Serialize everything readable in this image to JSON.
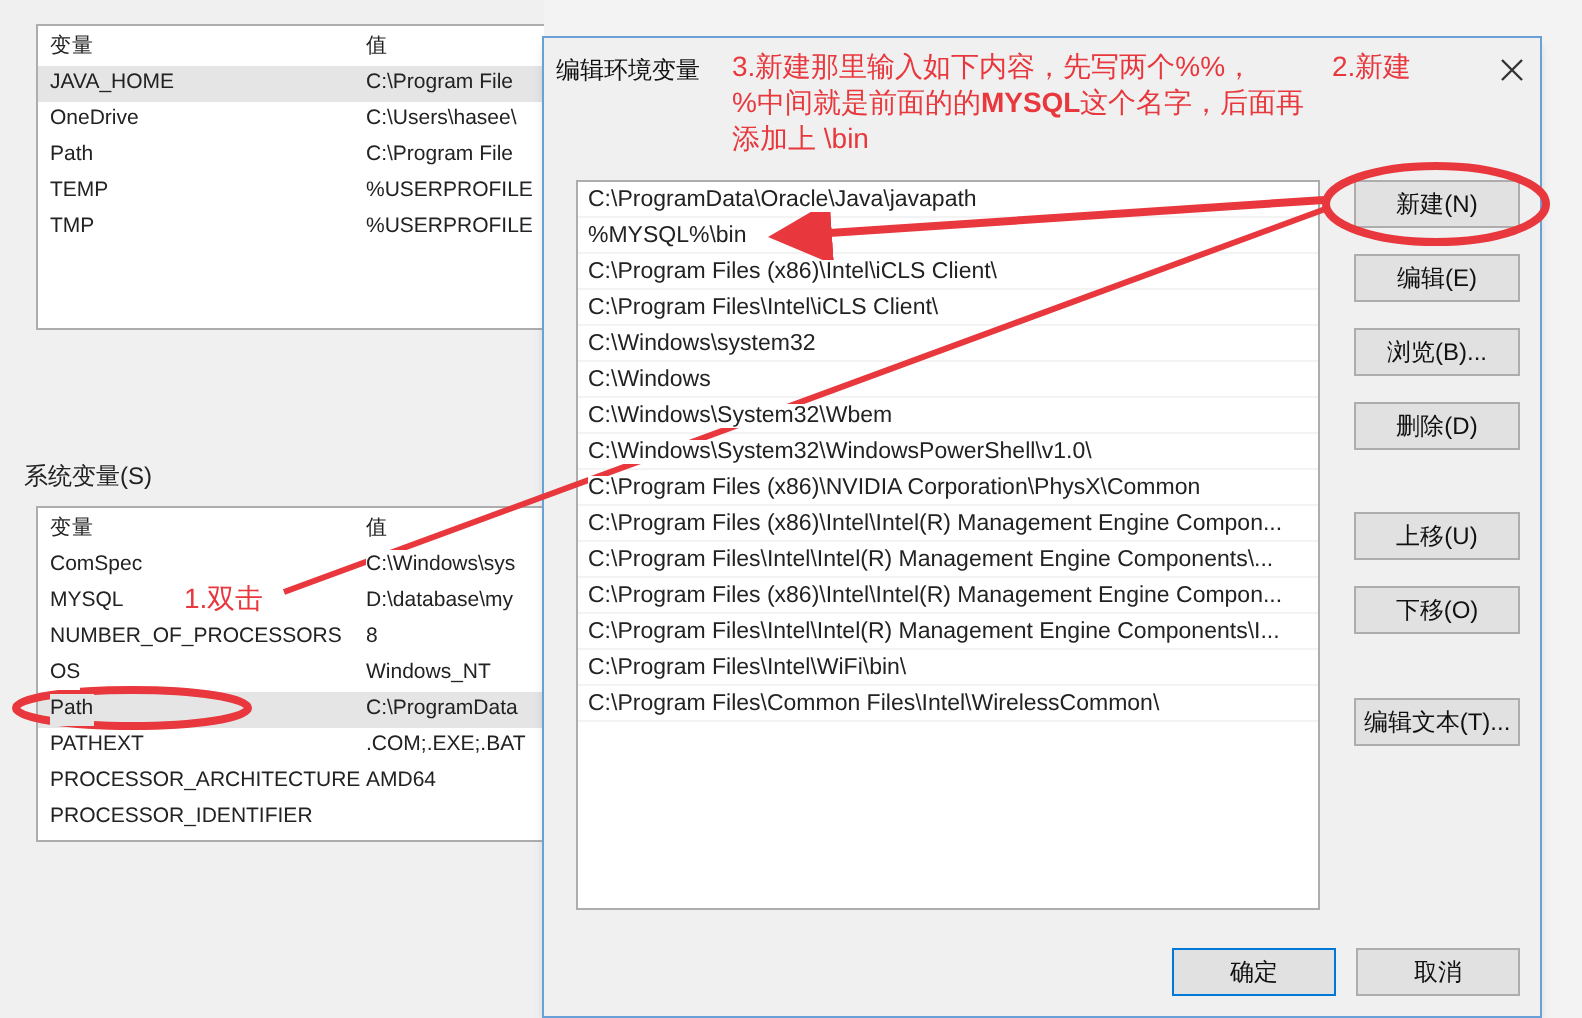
{
  "background_window": {
    "user_variables": {
      "columns": [
        "变量",
        "值"
      ],
      "rows": [
        {
          "name": "JAVA_HOME",
          "value": "C:\\Program File",
          "selected": true
        },
        {
          "name": "OneDrive",
          "value": "C:\\Users\\hasee\\",
          "selected": false
        },
        {
          "name": "Path",
          "value": "C:\\Program File",
          "selected": false
        },
        {
          "name": "TEMP",
          "value": "%USERPROFILE",
          "selected": false
        },
        {
          "name": "TMP",
          "value": "%USERPROFILE",
          "selected": false
        }
      ]
    },
    "system_variables": {
      "label": "系统变量(S)",
      "columns": [
        "变量",
        "值"
      ],
      "rows": [
        {
          "name": "ComSpec",
          "value": "C:\\Windows\\sys",
          "selected": false
        },
        {
          "name": "MYSQL",
          "value": "D:\\database\\my",
          "selected": false
        },
        {
          "name": "NUMBER_OF_PROCESSORS",
          "value": "8",
          "selected": false
        },
        {
          "name": "OS",
          "value": "Windows_NT",
          "selected": false
        },
        {
          "name": "Path",
          "value": "C:\\ProgramData",
          "selected": true
        },
        {
          "name": "PATHEXT",
          "value": ".COM;.EXE;.BAT",
          "selected": false
        },
        {
          "name": "PROCESSOR_ARCHITECTURE",
          "value": "AMD64",
          "selected": false
        },
        {
          "name": "PROCESSOR_IDENTIFIER",
          "value": "",
          "selected": false
        }
      ]
    }
  },
  "dialog": {
    "title": "编辑环境变量",
    "entries": [
      "C:\\ProgramData\\Oracle\\Java\\javapath",
      "%MYSQL%\\bin",
      "C:\\Program Files (x86)\\Intel\\iCLS Client\\",
      "C:\\Program Files\\Intel\\iCLS Client\\",
      "C:\\Windows\\system32",
      "C:\\Windows",
      "C:\\Windows\\System32\\Wbem",
      "C:\\Windows\\System32\\WindowsPowerShell\\v1.0\\",
      "C:\\Program Files (x86)\\NVIDIA Corporation\\PhysX\\Common",
      "C:\\Program Files (x86)\\Intel\\Intel(R) Management Engine Compon...",
      "C:\\Program Files\\Intel\\Intel(R) Management Engine Components\\...",
      "C:\\Program Files (x86)\\Intel\\Intel(R) Management Engine Compon...",
      "C:\\Program Files\\Intel\\Intel(R) Management Engine Components\\I...",
      "C:\\Program Files\\Intel\\WiFi\\bin\\",
      "C:\\Program Files\\Common Files\\Intel\\WirelessCommon\\"
    ],
    "side_buttons": [
      "新建(N)",
      "编辑(E)",
      "浏览(B)...",
      "删除(D)",
      "上移(U)",
      "下移(O)",
      "编辑文本(T)..."
    ],
    "footer_buttons": [
      "确定",
      "取消"
    ]
  },
  "annotations": [
    {
      "kind": "step",
      "lines": [
        "1.双击"
      ]
    },
    {
      "kind": "step",
      "lines": [
        "2.新建"
      ]
    },
    {
      "kind": "step",
      "lines": [
        "3.新建那里输入如下内容，先写两个%%，",
        "%中间就是前面的的**MYSQL**这个名字，后面再",
        "添加上 \\bin"
      ]
    }
  ]
}
